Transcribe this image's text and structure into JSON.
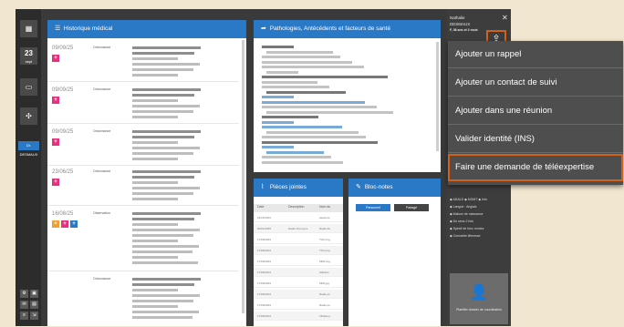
{
  "colors": {
    "accent": "#2a79c6",
    "highlight": "#d2611d",
    "pink": "#e7317f",
    "orange": "#f0a030"
  },
  "rail": {
    "apps_icon": "grid-icon",
    "date_day": "23",
    "date_label": "sept",
    "badge": "Dr. DESMAUX"
  },
  "historique": {
    "title": "Historique médical",
    "rows": [
      {
        "date": "09/09/25",
        "type": "Ordonnance"
      },
      {
        "date": "09/09/25",
        "type": "Ordonnance"
      },
      {
        "date": "09/09/25",
        "type": "Ordonnance"
      },
      {
        "date": "23/06/25",
        "type": "Ordonnance"
      },
      {
        "date": "16/08/25",
        "type": "Observation"
      },
      {
        "date": "",
        "type": "Ordonnance"
      }
    ]
  },
  "patho": {
    "title": "Pathologies, Antécédents et facteurs de santé"
  },
  "pieces": {
    "title": "Pièces jointes",
    "headers": [
      "Date",
      "Description",
      "Nom du"
    ],
    "rows": [
      [
        "24/11/2024",
        "",
        "asasrere"
      ],
      [
        "30/01/2025",
        "Radio Poumons",
        "Radio.bk"
      ],
      [
        "17/09/2024",
        "",
        "TO2.png"
      ],
      [
        "17/09/2024",
        "",
        "TO3.png"
      ],
      [
        "17/09/2024",
        "",
        "MRF.png"
      ],
      [
        "17/09/2024",
        "",
        "Sideline"
      ],
      [
        "17/09/2024",
        "",
        "MRF.jpg"
      ],
      [
        "17/09/2024",
        "",
        "Radio.pn"
      ],
      [
        "17/09/2024",
        "",
        "Radio.pn"
      ],
      [
        "17/09/2024",
        "",
        "Infidele.p"
      ]
    ]
  },
  "notes": {
    "title": "Bloc-notes",
    "btn_personal": "Personnel",
    "btn_shared": "Partagé"
  },
  "side": {
    "name": "Nathalie",
    "surname": "DESMAUX",
    "age": "F, 36 ans et 3 mois",
    "close_icon": "close-icon",
    "tags": [
      "ADALD",
      "MGMT",
      "Info",
      "Langue : Anglais",
      "Maison de naissance",
      "De sens 2 fois",
      "Spécif de fonc nomes",
      "Connaitre lifenesse"
    ],
    "coord_label": "Planifier dossier de coordination"
  },
  "share_icon": "share-icon",
  "menu": {
    "items": [
      "Ajouter un rappel",
      "Ajouter un contact de suivi",
      "Ajouter dans une réunion",
      "Valider identité (INS)",
      "Faire une demande de téléexpertise"
    ]
  }
}
